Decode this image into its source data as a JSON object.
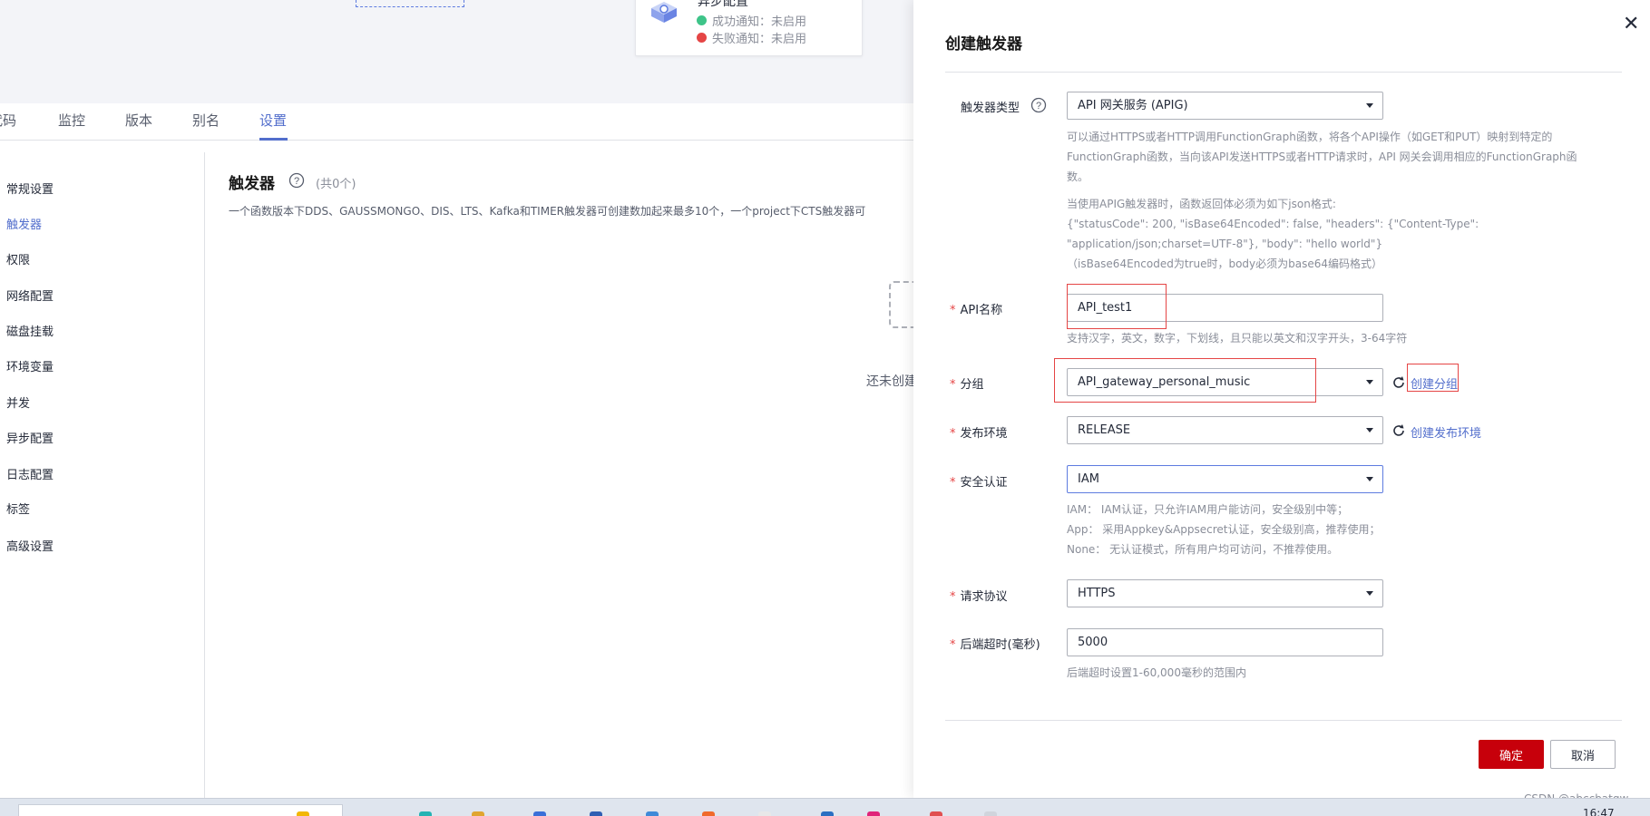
{
  "background": {
    "async_card": {
      "title": "异步配置",
      "success_label": "成功通知：未启用",
      "failure_label": "失败通知：未启用",
      "success_color": "#3ec489",
      "failure_color": "#e54545"
    },
    "tabs": [
      {
        "label": "代码"
      },
      {
        "label": "监控"
      },
      {
        "label": "版本"
      },
      {
        "label": "别名"
      },
      {
        "label": "设置",
        "active": true
      }
    ],
    "sidebar": [
      {
        "label": "常规设置"
      },
      {
        "label": "触发器",
        "active": true
      },
      {
        "label": "权限"
      },
      {
        "label": "网络配置"
      },
      {
        "label": "磁盘挂载"
      },
      {
        "label": "环境变量"
      },
      {
        "label": "并发"
      },
      {
        "label": "异步配置"
      },
      {
        "label": "日志配置"
      },
      {
        "label": "标签"
      },
      {
        "label": "高级设置"
      }
    ],
    "content": {
      "title": "触发器",
      "count": "(共0个)",
      "description": "一个函数版本下DDS、GAUSSMONGO、DIS、LTS、Kafka和TIMER触发器可创建数加起来最多10个，一个project下CTS触发器可",
      "empty_text": "还未创建"
    }
  },
  "dialog": {
    "title": "创建触发器",
    "trigger_type": {
      "label": "触发器类型",
      "value": "API 网关服务 (APIG)",
      "desc_lines": [
        "可以通过HTTPS或者HTTP调用FunctionGraph函数，将各个API操作（如GET和PUT）映射到特定的",
        "FunctionGraph函数，当向该API发送HTTPS或者HTTP请求时，API 网关会调用相应的FunctionGraph函",
        "数。"
      ],
      "format_lines": [
        "当使用APIG触发器时，函数返回体必须为如下json格式:",
        "{\"statusCode\": 200, \"isBase64Encoded\": false, \"headers\": {\"Content-Type\":",
        "\"application/json;charset=UTF-8\"}, \"body\": \"hello world\"}",
        "（isBase64Encoded为true时，body必须为base64编码格式）"
      ]
    },
    "api_name": {
      "label": "API名称",
      "value": "API_test1",
      "hint": "支持汉字，英文，数字，下划线，且只能以英文和汉字开头，3-64字符"
    },
    "group": {
      "label": "分组",
      "value": "API_gateway_personal_music",
      "link": "创建分组"
    },
    "env": {
      "label": "发布环境",
      "value": "RELEASE",
      "link": "创建发布环境"
    },
    "auth": {
      "label": "安全认证",
      "value": "IAM",
      "hint_lines": [
        "IAM： IAM认证，只允许IAM用户能访问，安全级别中等；",
        "App： 采用Appkey&Appsecret认证，安全级别高，推荐使用；",
        "None： 无认证模式，所有用户均可访问，不推荐使用。"
      ]
    },
    "protocol": {
      "label": "请求协议",
      "value": "HTTPS"
    },
    "timeout": {
      "label": "后端超时(毫秒)",
      "value": "5000",
      "hint": "后端超时设置1-60,000毫秒的范围内"
    },
    "ok_label": "确定",
    "cancel_label": "取消"
  },
  "watermark": "CSDN @abccbatqw",
  "taskbar": {
    "clock": "16:47"
  },
  "colors": {
    "primary": "#526ecc",
    "brand_red": "#c7000b",
    "annotation_red": "#e54545"
  }
}
